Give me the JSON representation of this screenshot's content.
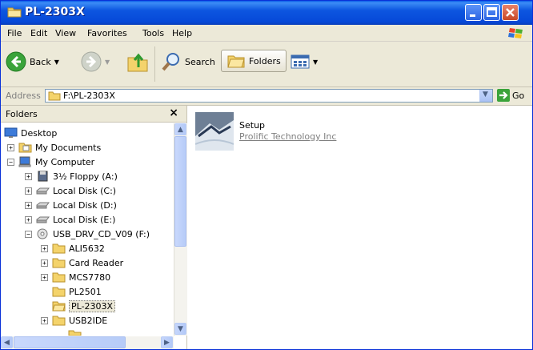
{
  "window": {
    "title": "PL-2303X"
  },
  "menu": {
    "items": [
      "File",
      "Edit",
      "View",
      "Favorites",
      "Tools",
      "Help"
    ]
  },
  "toolbar": {
    "back_label": "Back",
    "search_label": "Search",
    "folders_label": "Folders"
  },
  "address": {
    "label": "Address",
    "value": "F:\\PL-2303X",
    "go_label": "Go"
  },
  "folders_pane": {
    "title": "Folders",
    "close_glyph": "×",
    "tree": [
      {
        "label": "Desktop",
        "icon": "desktop-icon",
        "expander": ""
      },
      {
        "label": "My Documents",
        "icon": "my-documents-icon",
        "expander": "+"
      },
      {
        "label": "My Computer",
        "icon": "my-computer-icon",
        "expander": "−"
      },
      {
        "label": "3½ Floppy (A:)",
        "icon": "floppy-icon",
        "expander": "+"
      },
      {
        "label": "Local Disk (C:)",
        "icon": "disk-icon",
        "expander": "+"
      },
      {
        "label": "Local Disk (D:)",
        "icon": "disk-icon",
        "expander": "+"
      },
      {
        "label": "Local Disk (E:)",
        "icon": "disk-icon",
        "expander": "+"
      },
      {
        "label": "USB_DRV_CD_V09 (F:)",
        "icon": "cd-drive-icon",
        "expander": "−"
      },
      {
        "label": "ALI5632",
        "icon": "folder-icon",
        "expander": "+"
      },
      {
        "label": "Card Reader",
        "icon": "folder-icon",
        "expander": "+"
      },
      {
        "label": "MCS7780",
        "icon": "folder-icon",
        "expander": "+"
      },
      {
        "label": "PL2501",
        "icon": "folder-icon",
        "expander": ""
      },
      {
        "label": "PL-2303X",
        "icon": "folder-icon",
        "expander": "",
        "selected": true
      },
      {
        "label": "USB2IDE",
        "icon": "folder-icon",
        "expander": "+"
      }
    ]
  },
  "content": {
    "files": [
      {
        "name": "Setup",
        "company": "Prolific Technology Inc",
        "icon": "setup-installer-icon"
      }
    ]
  },
  "colors": {
    "titlebar": "#0648d8",
    "chrome": "#ece9d8",
    "folder_yellow": "#f4d36b",
    "go_green": "#3aa33a"
  }
}
